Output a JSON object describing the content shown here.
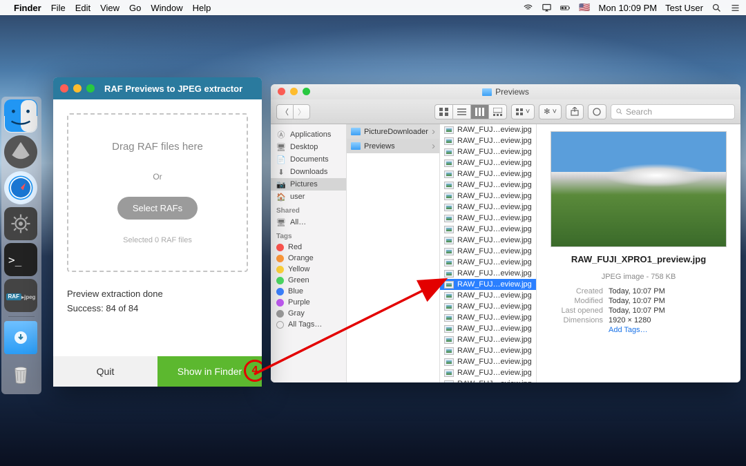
{
  "menubar": {
    "app": "Finder",
    "items": [
      "File",
      "Edit",
      "View",
      "Go",
      "Window",
      "Help"
    ],
    "clock": "Mon 10:09 PM",
    "user": "Test User"
  },
  "dock": {
    "raf_label": "RAF\n▸jpeg"
  },
  "raf": {
    "title": "RAF Previews to JPEG extractor",
    "drag_label": "Drag RAF files here",
    "or_label": "Or",
    "select_btn": "Select RAFs",
    "selected_label": "Selected 0 RAF files",
    "status_line1": "Preview extraction done",
    "status_line2": "Success: 84 of 84",
    "quit_btn": "Quit",
    "show_btn": "Show in Finder",
    "callout_num": "4"
  },
  "finder": {
    "title": "Previews",
    "search_placeholder": "Search",
    "sidebar": {
      "favorites": [
        {
          "icon": "app",
          "label": "Applications"
        },
        {
          "icon": "desktop",
          "label": "Desktop"
        },
        {
          "icon": "doc",
          "label": "Documents"
        },
        {
          "icon": "down",
          "label": "Downloads"
        },
        {
          "icon": "pic",
          "label": "Pictures",
          "active": true
        },
        {
          "icon": "home",
          "label": "user"
        }
      ],
      "shared_header": "Shared",
      "shared": [
        {
          "icon": "net",
          "label": "All…"
        }
      ],
      "tags_header": "Tags",
      "tags": [
        {
          "color": "#ff5650",
          "label": "Red"
        },
        {
          "color": "#ff9a3b",
          "label": "Orange"
        },
        {
          "color": "#ffd33b",
          "label": "Yellow"
        },
        {
          "color": "#4cd964",
          "label": "Green"
        },
        {
          "color": "#3b82ff",
          "label": "Blue"
        },
        {
          "color": "#bf5af2",
          "label": "Purple"
        },
        {
          "color": "#9a9a9a",
          "label": "Gray"
        },
        {
          "color": "",
          "label": "All Tags…"
        }
      ]
    },
    "col1": [
      {
        "label": "PictureDownloader",
        "sel": true
      },
      {
        "label": "Previews",
        "sel": true,
        "hl": true
      }
    ],
    "col2_item": "RAW_FUJ…eview.jpg",
    "col2_count": 24,
    "col2_selected_index": 14,
    "preview": {
      "filename": "RAW_FUJI_XPRO1_preview.jpg",
      "subtitle": "JPEG image - 758 KB",
      "meta": [
        {
          "k": "Created",
          "v": "Today, 10:07 PM"
        },
        {
          "k": "Modified",
          "v": "Today, 10:07 PM"
        },
        {
          "k": "Last opened",
          "v": "Today, 10:07 PM"
        },
        {
          "k": "Dimensions",
          "v": "1920 × 1280"
        }
      ],
      "add_tags": "Add Tags…"
    }
  }
}
